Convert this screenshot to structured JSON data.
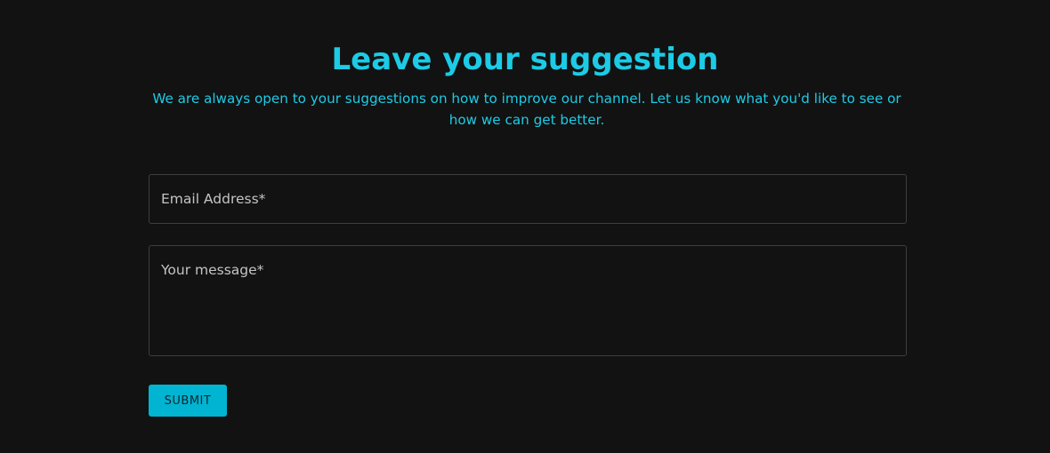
{
  "header": {
    "title": "Leave your suggestion",
    "subtitle": "We are always open to your suggestions on how to improve our channel. Let us know what you'd like to see or how we can get better."
  },
  "form": {
    "email_placeholder": "Email Address*",
    "email_value": "",
    "message_placeholder": "Your message*",
    "message_value": "",
    "submit_label": "SUBMIT"
  },
  "colors": {
    "background": "#121212",
    "accent": "#1ccbe6",
    "button": "#00b4d2",
    "field_border": "#3e3e3e"
  }
}
